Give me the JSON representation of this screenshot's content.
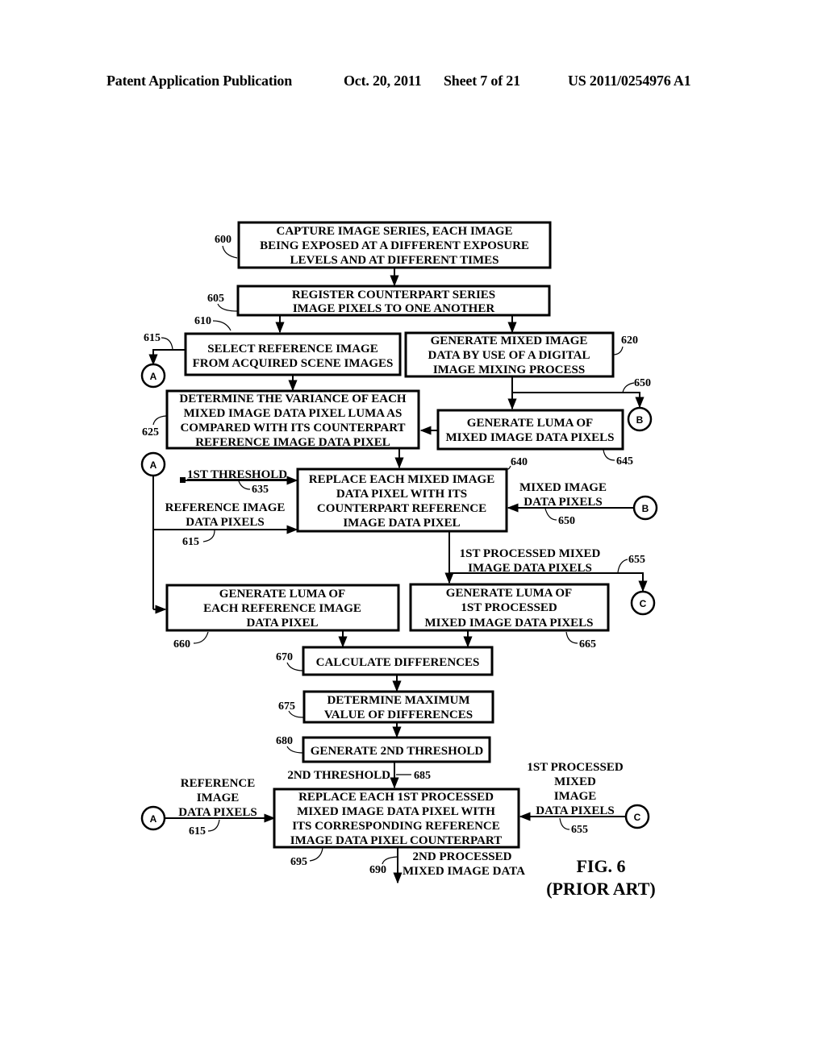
{
  "header": {
    "publication": "Patent Application Publication",
    "date": "Oct. 20, 2011",
    "sheet": "Sheet 7 of 21",
    "number": "US 2011/0254976 A1"
  },
  "boxes": {
    "b600": {
      "ref": "600",
      "lines": [
        "CAPTURE IMAGE SERIES, EACH IMAGE",
        "BEING EXPOSED AT  A DIFFERENT EXPOSURE",
        "LEVELS AND AT DIFFERENT TIMES"
      ]
    },
    "b605": {
      "ref": "605",
      "lines": [
        "REGISTER COUNTERPART SERIES",
        "IMAGE PIXELS TO ONE ANOTHER"
      ]
    },
    "b610": {
      "ref": "610",
      "lines": [
        "SELECT REFERENCE IMAGE",
        "FROM ACQUIRED SCENE IMAGES"
      ]
    },
    "b620": {
      "ref": "620",
      "lines": [
        "GENERATE MIXED IMAGE",
        "DATA BY USE OF A DIGITAL",
        "IMAGE MIXING PROCESS"
      ]
    },
    "b625": {
      "ref": "625",
      "lines": [
        "DETERMINE THE VARIANCE OF EACH",
        "MIXED IMAGE DATA PIXEL LUMA AS",
        "COMPARED WITH ITS COUNTERPART",
        "REFERENCE IMAGE DATA PIXEL"
      ]
    },
    "b645": {
      "ref": "645",
      "lines": [
        "GENERATE LUMA OF",
        "MIXED IMAGE DATA PIXELS"
      ]
    },
    "b640": {
      "ref": "640",
      "lines": [
        "REPLACE EACH MIXED IMAGE",
        "DATA PIXEL WITH ITS",
        "COUNTERPART REFERENCE",
        "IMAGE DATA PIXEL"
      ]
    },
    "b660": {
      "ref": "660",
      "lines": [
        "GENERATE LUMA OF",
        "EACH REFERENCE IMAGE",
        "DATA PIXEL"
      ]
    },
    "b665": {
      "ref": "665",
      "lines": [
        "GENERATE LUMA OF",
        "1ST PROCESSED",
        "MIXED IMAGE DATA PIXELS"
      ]
    },
    "b670": {
      "ref": "670",
      "lines": [
        "CALCULATE DIFFERENCES"
      ]
    },
    "b675": {
      "ref": "675",
      "lines": [
        "DETERMINE MAXIMUM",
        "VALUE OF DIFFERENCES"
      ]
    },
    "b680": {
      "ref": "680",
      "lines": [
        "GENERATE 2ND THRESHOLD"
      ]
    },
    "b695": {
      "ref": "695",
      "lines": [
        "REPLACE EACH 1ST PROCESSED",
        "MIXED IMAGE DATA PIXEL WITH",
        "ITS CORRESPONDING REFERENCE",
        "IMAGE DATA PIXEL COUNTERPART"
      ]
    }
  },
  "connectors": {
    "A": "A",
    "B": "B",
    "C": "C"
  },
  "labels": {
    "ref615_top": "615",
    "ref650_top": "650",
    "first_threshold": "1ST THRESHOLD",
    "ref635": "635",
    "ref_image_pixels": [
      "REFERENCE IMAGE",
      "DATA PIXELS"
    ],
    "ref615_mid": "615",
    "mixed_pixels": [
      "MIXED IMAGE",
      "DATA PIXELS"
    ],
    "ref650_mid": "650",
    "first_processed": [
      "1ST PROCESSED MIXED",
      "IMAGE DATA PIXELS"
    ],
    "ref655_top": "655",
    "second_threshold": "2ND THRESHOLD",
    "ref685": "685",
    "ref_image_pixels_bottom": [
      "REFERENCE",
      "IMAGE",
      "DATA PIXELS"
    ],
    "ref615_bottom": "615",
    "first_processed_bottom": [
      "1ST PROCESSED",
      "MIXED",
      "IMAGE",
      "DATA PIXELS"
    ],
    "ref655_bottom": "655",
    "second_processed": [
      "2ND PROCESSED",
      "MIXED IMAGE DATA"
    ],
    "ref690": "690"
  },
  "figure": {
    "title": "FIG. 6",
    "subtitle": "(PRIOR ART)"
  }
}
